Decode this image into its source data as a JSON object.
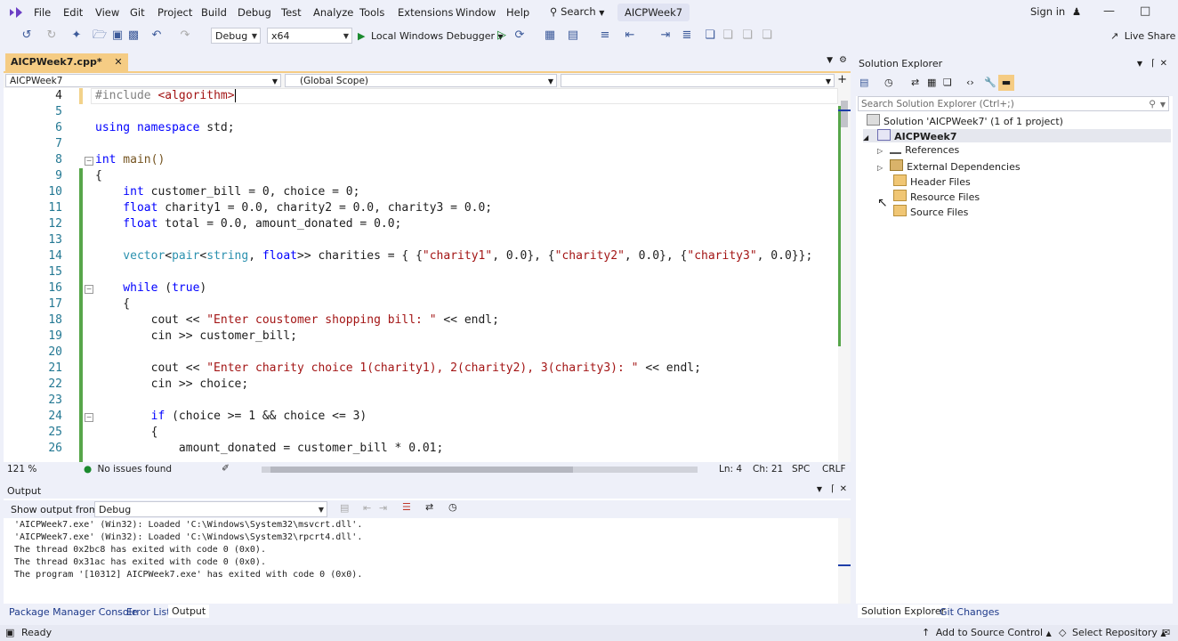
{
  "menu": {
    "items": [
      "File",
      "Edit",
      "View",
      "Git",
      "Project",
      "Build",
      "Debug",
      "Test",
      "Analyze",
      "Tools",
      "Extensions",
      "Window",
      "Help"
    ],
    "search": "Search",
    "solution_title": "AICPWeek7",
    "sign_in": "Sign in"
  },
  "toolbar": {
    "config": "Debug",
    "platform": "x64",
    "debugger": "Local Windows Debugger",
    "live_share": "Live Share"
  },
  "editor": {
    "tab_label": "AICPWeek7.cpp*",
    "nav_project": "AICPWeek7",
    "nav_scope": "(Global Scope)",
    "lines": [
      {
        "n": "4"
      },
      {
        "n": "5"
      },
      {
        "n": "6"
      },
      {
        "n": "7"
      },
      {
        "n": "8"
      },
      {
        "n": "9"
      },
      {
        "n": "10"
      },
      {
        "n": "11"
      },
      {
        "n": "12"
      },
      {
        "n": "13"
      },
      {
        "n": "14"
      },
      {
        "n": "15"
      },
      {
        "n": "16"
      },
      {
        "n": "17"
      },
      {
        "n": "18"
      },
      {
        "n": "19"
      },
      {
        "n": "20"
      },
      {
        "n": "21"
      },
      {
        "n": "22"
      },
      {
        "n": "23"
      },
      {
        "n": "24"
      },
      {
        "n": "25"
      },
      {
        "n": "26"
      }
    ],
    "code": {
      "l4_a": "#include ",
      "l4_b": "<algorithm>",
      "l6_a": "using",
      "l6_b": " namespace ",
      "l6_c": "std;",
      "l8_a": "int",
      "l8_b": " main()",
      "l9": "{",
      "l10_a": "    int",
      "l10_b": " customer_bill = 0, choice = 0;",
      "l11_a": "    float",
      "l11_b": " charity1 = 0.0, charity2 = 0.0, charity3 = 0.0;",
      "l12_a": "    float",
      "l12_b": " total = 0.0, amount_donated = 0.0;",
      "l14_a": "    vector",
      "l14_b": "<",
      "l14_c": "pair",
      "l14_d": "<",
      "l14_e": "string",
      "l14_f": ", ",
      "l14_g": "float",
      "l14_h": ">> charities = { {",
      "l14_s1": "\"charity1\"",
      "l14_i": ", 0.0}, {",
      "l14_s2": "\"charity2\"",
      "l14_j": ", 0.0}, {",
      "l14_s3": "\"charity3\"",
      "l14_k": ", 0.0}};",
      "l16_a": "    while",
      "l16_b": " (",
      "l16_c": "true",
      "l16_d": ")",
      "l17": "    {",
      "l18_a": "        cout << ",
      "l18_s": "\"Enter coustomer shopping bill: \"",
      "l18_b": " << endl;",
      "l19": "        cin >> customer_bill;",
      "l21_a": "        cout << ",
      "l21_s": "\"Enter charity choice 1(charity1), 2(charity2), 3(charity3): \"",
      "l21_b": " << endl;",
      "l22": "        cin >> choice;",
      "l24_a": "        if",
      "l24_b": " (choice >= 1 && choice <= 3)",
      "l25": "        {",
      "l26": "            amount_donated = customer_bill * 0.01;"
    },
    "zoom": "121 %",
    "issues": "No issues found",
    "ln": "Ln: 4",
    "ch": "Ch: 21",
    "spc": "SPC",
    "crlf": "CRLF"
  },
  "output": {
    "title": "Output",
    "show_from_label": "Show output from:",
    "show_from_value": "Debug",
    "lines": [
      "'AICPWeek7.exe' (Win32): Loaded 'C:\\Windows\\System32\\msvcrt.dll'.",
      "'AICPWeek7.exe' (Win32): Loaded 'C:\\Windows\\System32\\rpcrt4.dll'.",
      "The thread 0x2bc8 has exited with code 0 (0x0).",
      "The thread 0x31ac has exited with code 0 (0x0).",
      "The program '[10312] AICPWeek7.exe' has exited with code 0 (0x0)."
    ],
    "tabs": [
      "Package Manager Console",
      "Error List",
      "Output"
    ]
  },
  "solution_explorer": {
    "title": "Solution Explorer",
    "search_placeholder": "Search Solution Explorer (Ctrl+;)",
    "solution": "Solution 'AICPWeek7' (1 of 1 project)",
    "project": "AICPWeek7",
    "nodes": [
      "References",
      "External Dependencies",
      "Header Files",
      "Resource Files",
      "Source Files"
    ],
    "tabs": [
      "Solution Explorer",
      "Git Changes"
    ]
  },
  "statusbar": {
    "ready": "Ready",
    "add_source": "Add to Source Control",
    "select_repo": "Select Repository"
  },
  "colors": {
    "accent_tab": "#f5cc84",
    "change_bar": "#57a64a",
    "keyword": "#0000ff",
    "type": "#2b91af",
    "string": "#a31515"
  }
}
